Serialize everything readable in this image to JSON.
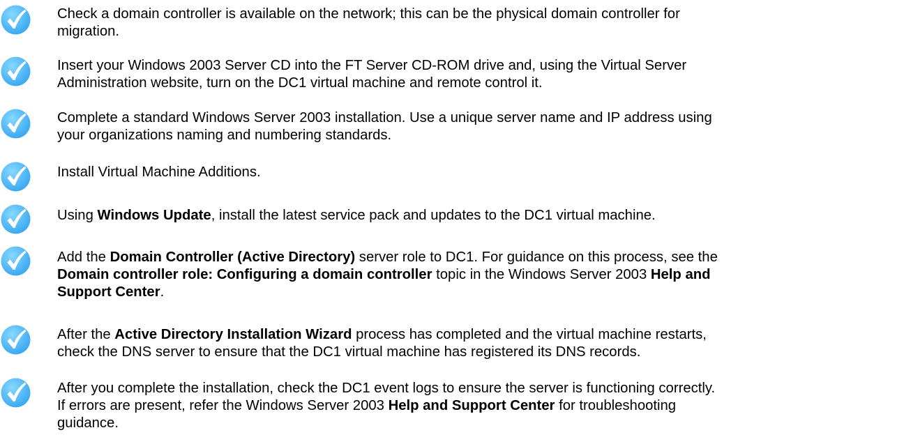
{
  "icon": {
    "name": "checkmark-icon",
    "circle_color_light": "#86d8ff",
    "circle_color_dark": "#3aa8f2",
    "check_color": "#ffffff"
  },
  "items": [
    {
      "lines": [
        [
          {
            "t": "Check a domain controller is available on the network; this can be the physical domain controller for"
          }
        ],
        [
          {
            "t": "migration."
          }
        ]
      ]
    },
    {
      "lines": [
        [
          {
            "t": "Insert your Windows 2003 Server CD into the FT Server CD-ROM drive and, using the Virtual Server"
          }
        ],
        [
          {
            "t": "Administration website, turn on the DC1 virtual machine and remote control it."
          }
        ]
      ]
    },
    {
      "lines": [
        [
          {
            "t": "Complete a standard Windows Server 2003 installation. Use a unique server name and IP address using"
          }
        ],
        [
          {
            "t": "your organizations naming and numbering standards."
          }
        ]
      ]
    },
    {
      "lines": [
        [
          {
            "t": "Install Virtual Machine Additions."
          }
        ]
      ]
    },
    {
      "lines": [
        [
          {
            "t": "Using "
          },
          {
            "t": "Windows Update",
            "b": true
          },
          {
            "t": ", install the latest service pack and updates to the DC1 virtual machine."
          }
        ]
      ]
    },
    {
      "lines": [
        [
          {
            "t": "Add the "
          },
          {
            "t": "Domain Controller (Active Directory)",
            "b": true
          },
          {
            "t": " server role to DC1. For guidance on this process, see the"
          }
        ],
        [
          {
            "t": "Domain controller role: Configuring a domain controller",
            "b": true
          },
          {
            "t": " topic in the Windows Server 2003 "
          },
          {
            "t": "Help and",
            "b": true
          }
        ],
        [
          {
            "t": "Support Center",
            "b": true
          },
          {
            "t": "."
          }
        ]
      ]
    },
    {
      "lines": [
        [
          {
            "t": "After the "
          },
          {
            "t": "Active Directory Installation Wizard",
            "b": true
          },
          {
            "t": " process has completed and the virtual machine restarts,"
          }
        ],
        [
          {
            "t": "check the DNS server to ensure that the DC1 virtual machine has registered its DNS records."
          }
        ]
      ]
    },
    {
      "lines": [
        [
          {
            "t": "After you complete the installation, check the DC1 event logs to ensure the server is functioning correctly."
          }
        ],
        [
          {
            "t": "If errors are present, refer the Windows Server 2003 "
          },
          {
            "t": "Help and Support Center",
            "b": true
          },
          {
            "t": " for troubleshooting"
          }
        ],
        [
          {
            "t": "guidance."
          }
        ]
      ]
    }
  ]
}
